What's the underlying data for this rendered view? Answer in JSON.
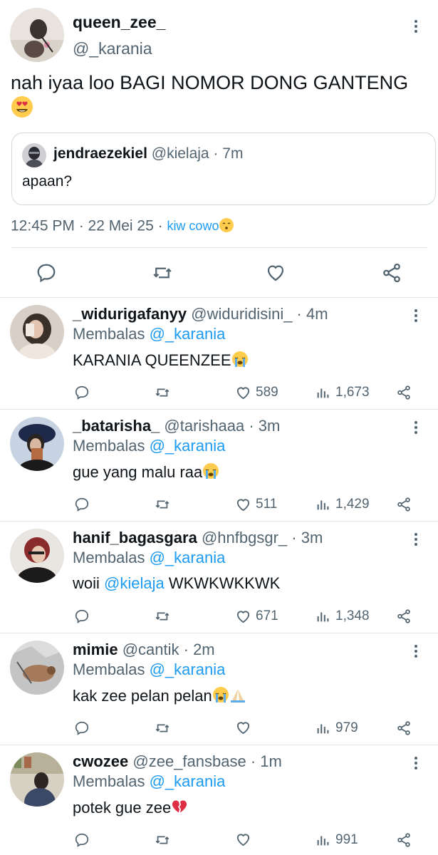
{
  "main_tweet": {
    "display_name": "queen_zee_",
    "handle": "@_karania",
    "text": "nah iyaa loo BAGI NOMOR DONG GANTENG",
    "emoji": "heart-eyes",
    "quoted": {
      "display_name": "jendraezekiel",
      "handle_time": "@kielaja · 7m",
      "text": "apaan?"
    },
    "timestamp": "12:45 PM · 22 Mei 25 · ",
    "source": "kiw cowo"
  },
  "replies": [
    {
      "display_name": "_widurigafanyy",
      "handle_time": "@widuridisini_ · 4m",
      "replying_prefix": "Membalas ",
      "replying_to": "@_karania",
      "text": "KARANIA QUEENZEE",
      "likes": "589",
      "views": "1,673"
    },
    {
      "display_name": "_batarisha_",
      "handle_time": "@tarishaaa · 3m",
      "replying_prefix": "Membalas ",
      "replying_to": "@_karania",
      "text": "gue yang malu raa",
      "likes": "511",
      "views": "1,429"
    },
    {
      "display_name": "hanif_bagasgara",
      "handle_time": "@hnfbgsgr_ · 3m",
      "replying_prefix": "Membalas ",
      "replying_to": "@_karania",
      "text_prefix": "woii ",
      "text_mention": "@kielaja",
      "text_suffix": " WKWKWKKWK",
      "likes": "671",
      "views": "1,348"
    },
    {
      "display_name": "mimie",
      "handle_time": "@cantik · 2m",
      "replying_prefix": "Membalas ",
      "replying_to": "@_karania",
      "text": "kak zee pelan pelan",
      "likes": "",
      "views": "979"
    },
    {
      "display_name": "cwozee",
      "handle_time": "@zee_fansbase · 1m",
      "replying_prefix": "Membalas ",
      "replying_to": "@_karania",
      "text": "potek gue zee",
      "likes": "",
      "views": "991"
    }
  ],
  "colors": {
    "text": "#0f1419",
    "secondary": "#536471",
    "accent": "#1d9bf0",
    "divider": "#e4e8eb"
  }
}
